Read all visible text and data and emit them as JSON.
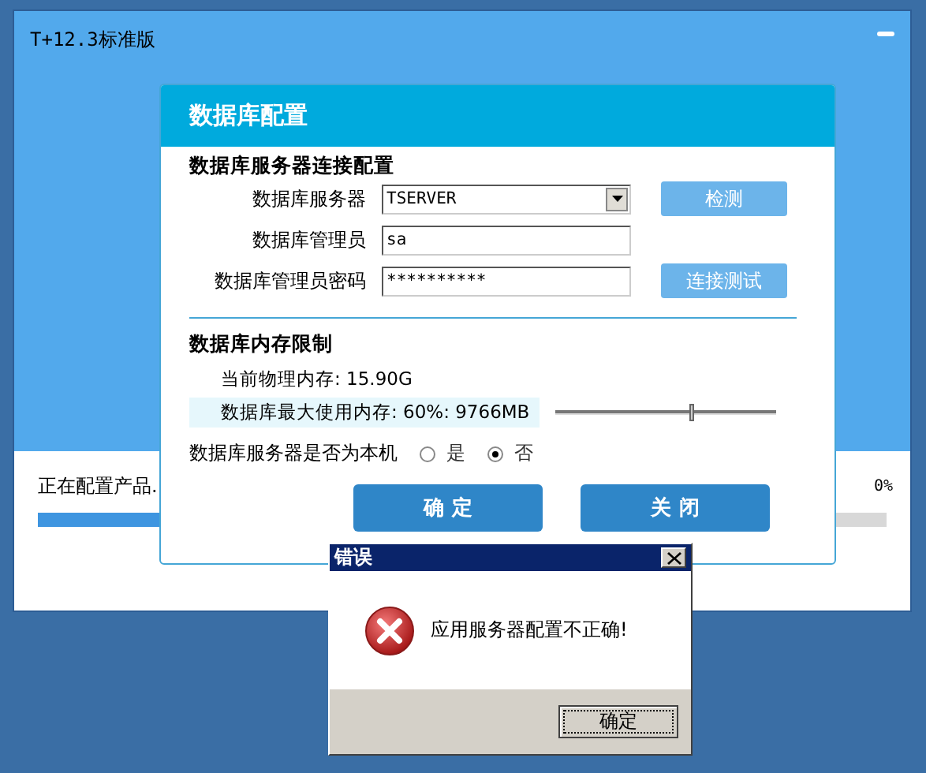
{
  "window": {
    "title": "T+12.3标准版"
  },
  "progress": {
    "label": "正在配置产品.",
    "percent": "0%",
    "level": 0.3
  },
  "db_dialog": {
    "title": "数据库配置",
    "connection": {
      "heading": "数据库服务器连接配置",
      "fields": [
        {
          "kind": "dropdown",
          "label": "数据库服务器",
          "value": "TSERVER",
          "button": "检测"
        },
        {
          "kind": "text",
          "label": "数据库管理员",
          "value": "sa"
        },
        {
          "kind": "text",
          "label": "数据库管理员密码",
          "value": "**********",
          "button": "连接测试"
        }
      ]
    },
    "memory": {
      "heading": "数据库内存限制",
      "physical": "当前物理内存: 15.90G",
      "max_label": "数据库最大使用内存: 60%: 9766MB",
      "level": 0.62
    },
    "local": {
      "label": "数据库服务器是否为本机",
      "options": [
        {
          "label": "是",
          "selected": false
        },
        {
          "label": "否",
          "selected": true
        }
      ]
    },
    "buttons": [
      "确 定",
      "关 闭"
    ]
  },
  "error_dialog": {
    "title": "错误",
    "message": "应用服务器配置不正确!",
    "button": "确定"
  }
}
